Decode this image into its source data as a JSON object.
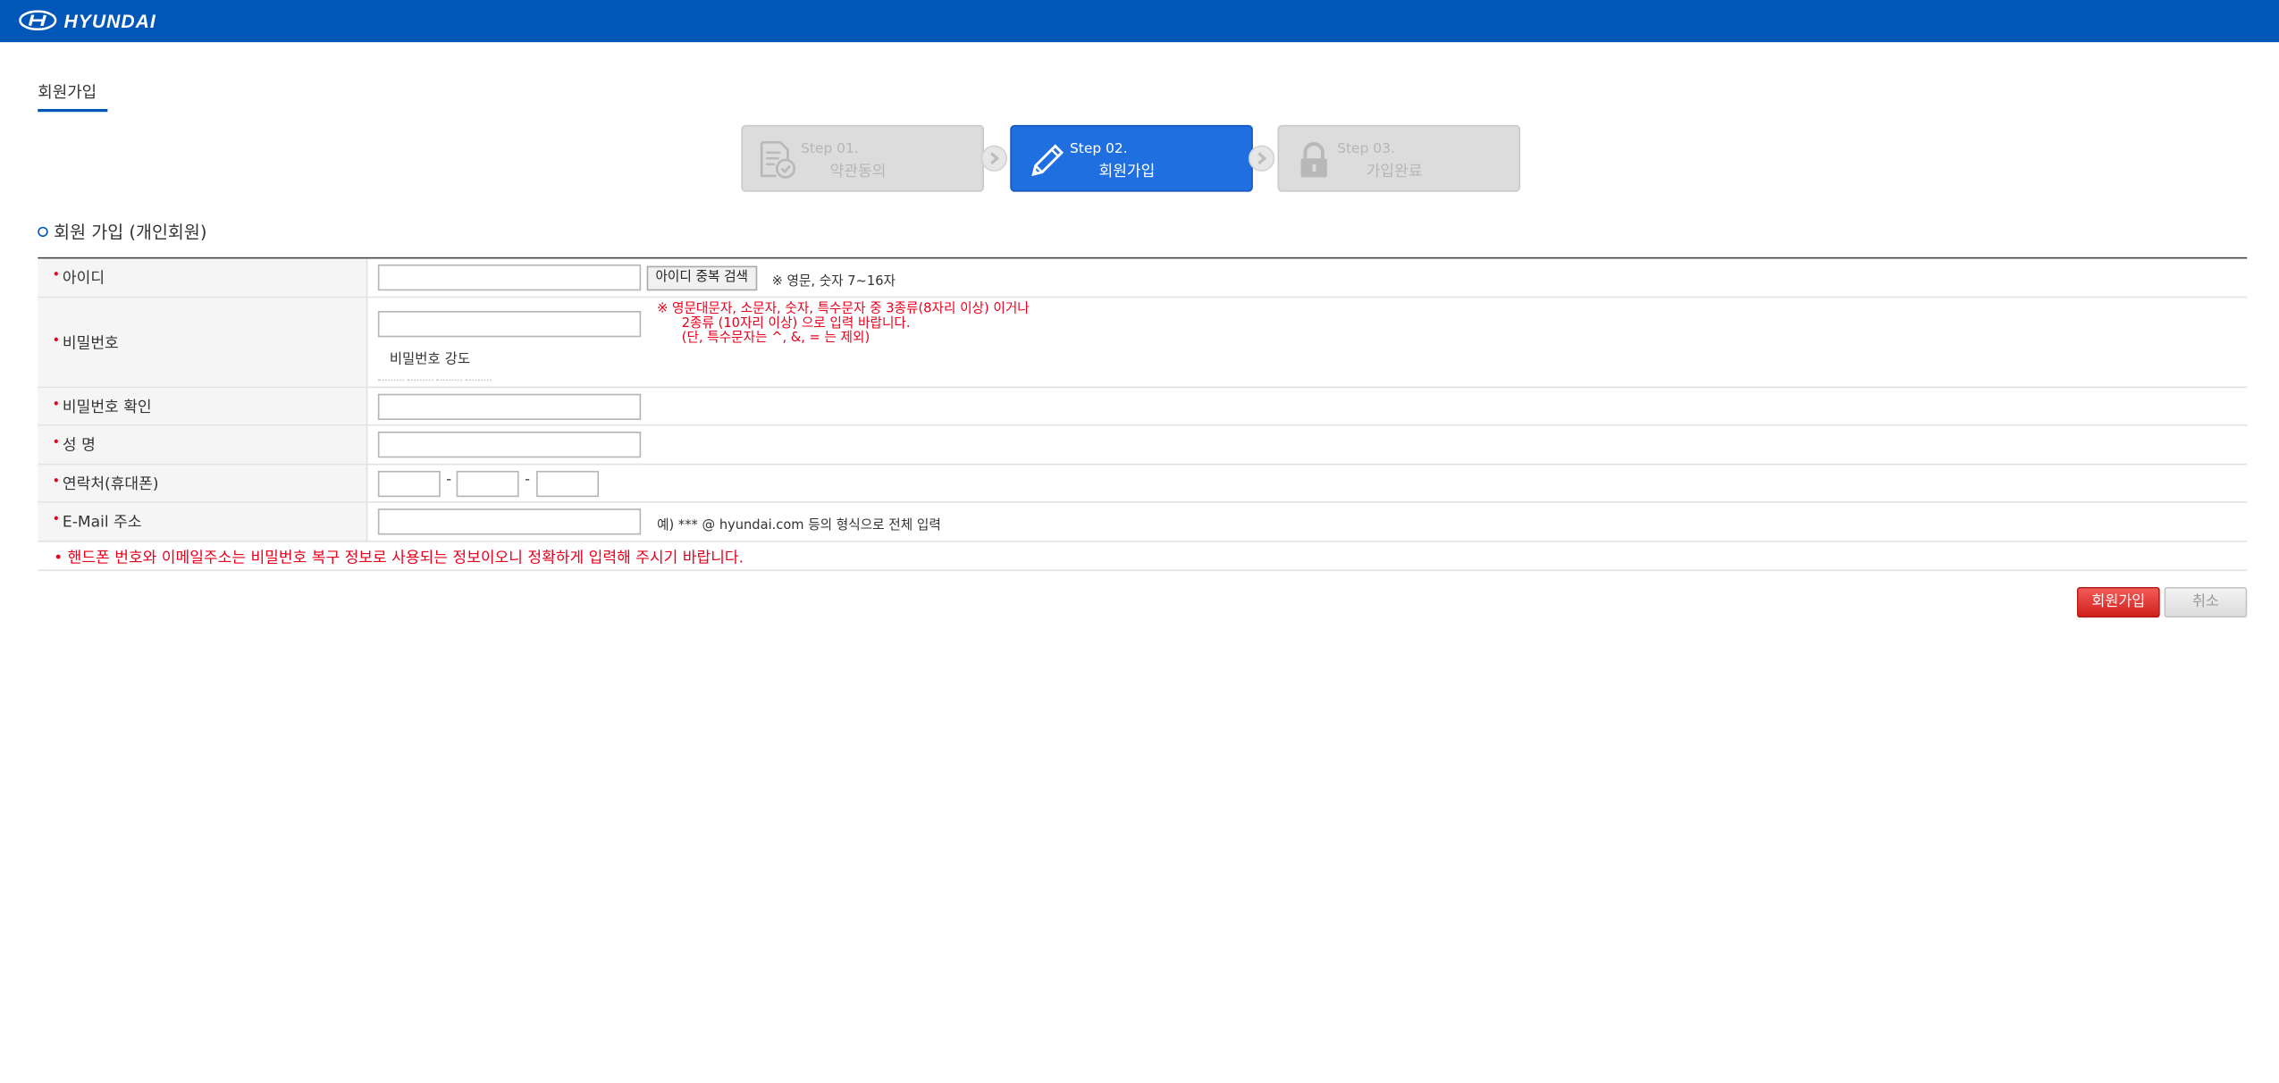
{
  "header": {
    "brand": "HYUNDAI"
  },
  "page_title": "회원가입",
  "steps": [
    {
      "num": "Step 01.",
      "label": "약관동의",
      "state": "done"
    },
    {
      "num": "Step 02.",
      "label": "회원가입",
      "state": "active"
    },
    {
      "num": "Step 03.",
      "label": "가입완료",
      "state": "pending"
    }
  ],
  "section_title": "회원 가입 (개인회원)",
  "form": {
    "id": {
      "label": "아이디",
      "check_button": "아이디 중복 검색",
      "hint": "※ 영문, 숫자 7~16자",
      "value": ""
    },
    "password": {
      "label": "비밀번호",
      "value": "",
      "hint_line1": "※ 영문대문자, 소문자, 숫자, 특수문자 중 3종류(8자리 이상) 이거나",
      "hint_line2": "2종류 (10자리 이상) 으로 입력 바랍니다.",
      "hint_line3": "(단, 특수문자는 ^, &, = 는 제외)",
      "strength_label": "비밀번호 강도"
    },
    "password_confirm": {
      "label": "비밀번호 확인",
      "value": ""
    },
    "name": {
      "label": "성 명",
      "value": ""
    },
    "phone": {
      "label": "연락처(휴대폰)",
      "part1": "",
      "part2": "",
      "part3": "",
      "separator": "-"
    },
    "email": {
      "label": "E-Mail 주소",
      "value": "",
      "hint": "예) *** @ hyundai.com 등의 형식으로 전체 입력"
    },
    "notice": "• 핸드폰 번호와 이메일주소는 비밀번호 복구 정보로 사용되는 정보이오니 정확하게 입력해 주시기 바랍니다.",
    "required_mark": "•"
  },
  "actions": {
    "submit": "회원가입",
    "cancel": "취소"
  },
  "colors": {
    "brand_blue": "#0057b8",
    "active_step": "#1f6fe0",
    "required_red": "#e8001c",
    "submit_red": "#d0201c"
  }
}
